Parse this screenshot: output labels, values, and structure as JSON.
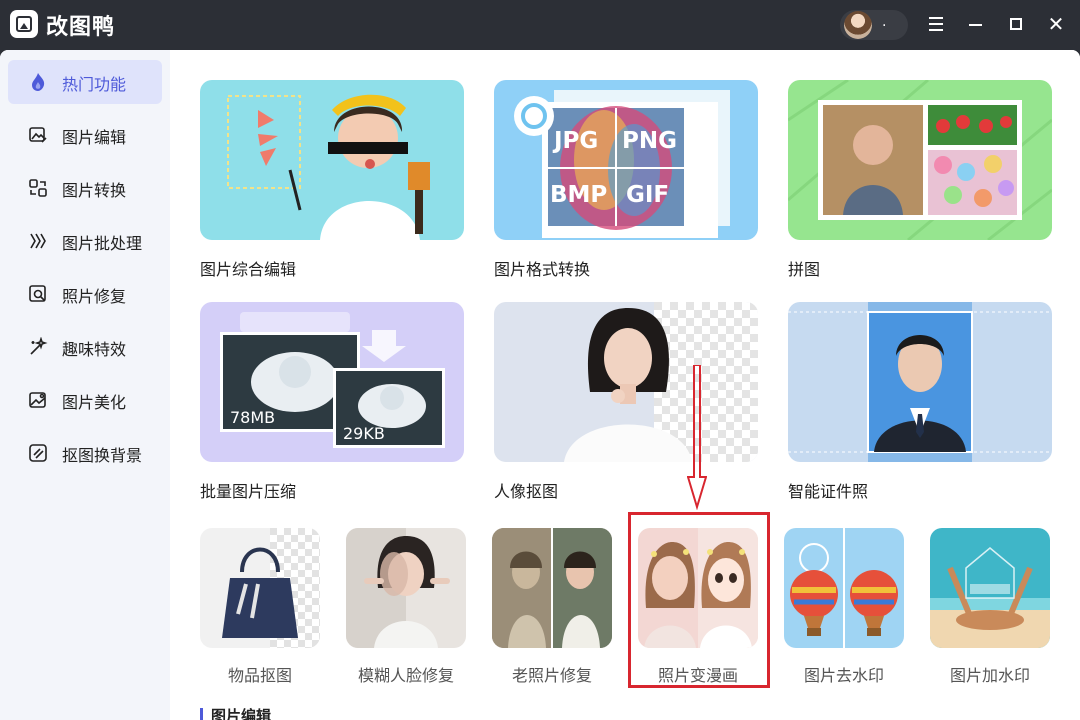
{
  "app": {
    "title": "改图鸭",
    "user_name": "."
  },
  "sidebar": {
    "items": [
      {
        "label": "热门功能",
        "icon": "flame-icon",
        "active": true
      },
      {
        "label": "图片编辑",
        "icon": "image-edit-icon"
      },
      {
        "label": "图片转换",
        "icon": "convert-icon"
      },
      {
        "label": "图片批处理",
        "icon": "batch-icon"
      },
      {
        "label": "照片修复",
        "icon": "photo-repair-icon"
      },
      {
        "label": "趣味特效",
        "icon": "magic-icon"
      },
      {
        "label": "图片美化",
        "icon": "beautify-icon"
      },
      {
        "label": "抠图换背景",
        "icon": "cutout-icon"
      }
    ]
  },
  "features": {
    "large": [
      {
        "label": "图片综合编辑"
      },
      {
        "label": "图片格式转换",
        "formats": [
          "JPG",
          "PNG",
          "BMP",
          "GIF"
        ]
      },
      {
        "label": "拼图"
      },
      {
        "label": "批量图片压缩",
        "size_before": "78MB",
        "size_after": "29KB"
      },
      {
        "label": "人像抠图"
      },
      {
        "label": "智能证件照"
      }
    ],
    "small": [
      {
        "label": "物品抠图"
      },
      {
        "label": "模糊人脸修复"
      },
      {
        "label": "老照片修复"
      },
      {
        "label": "照片变漫画"
      },
      {
        "label": "图片去水印"
      },
      {
        "label": "图片加水印"
      }
    ]
  },
  "section": {
    "next_title": "图片编辑"
  },
  "colors": {
    "accent": "#4e5ad9",
    "highlight": "#d8262f",
    "titlebar": "#2c2f36"
  }
}
